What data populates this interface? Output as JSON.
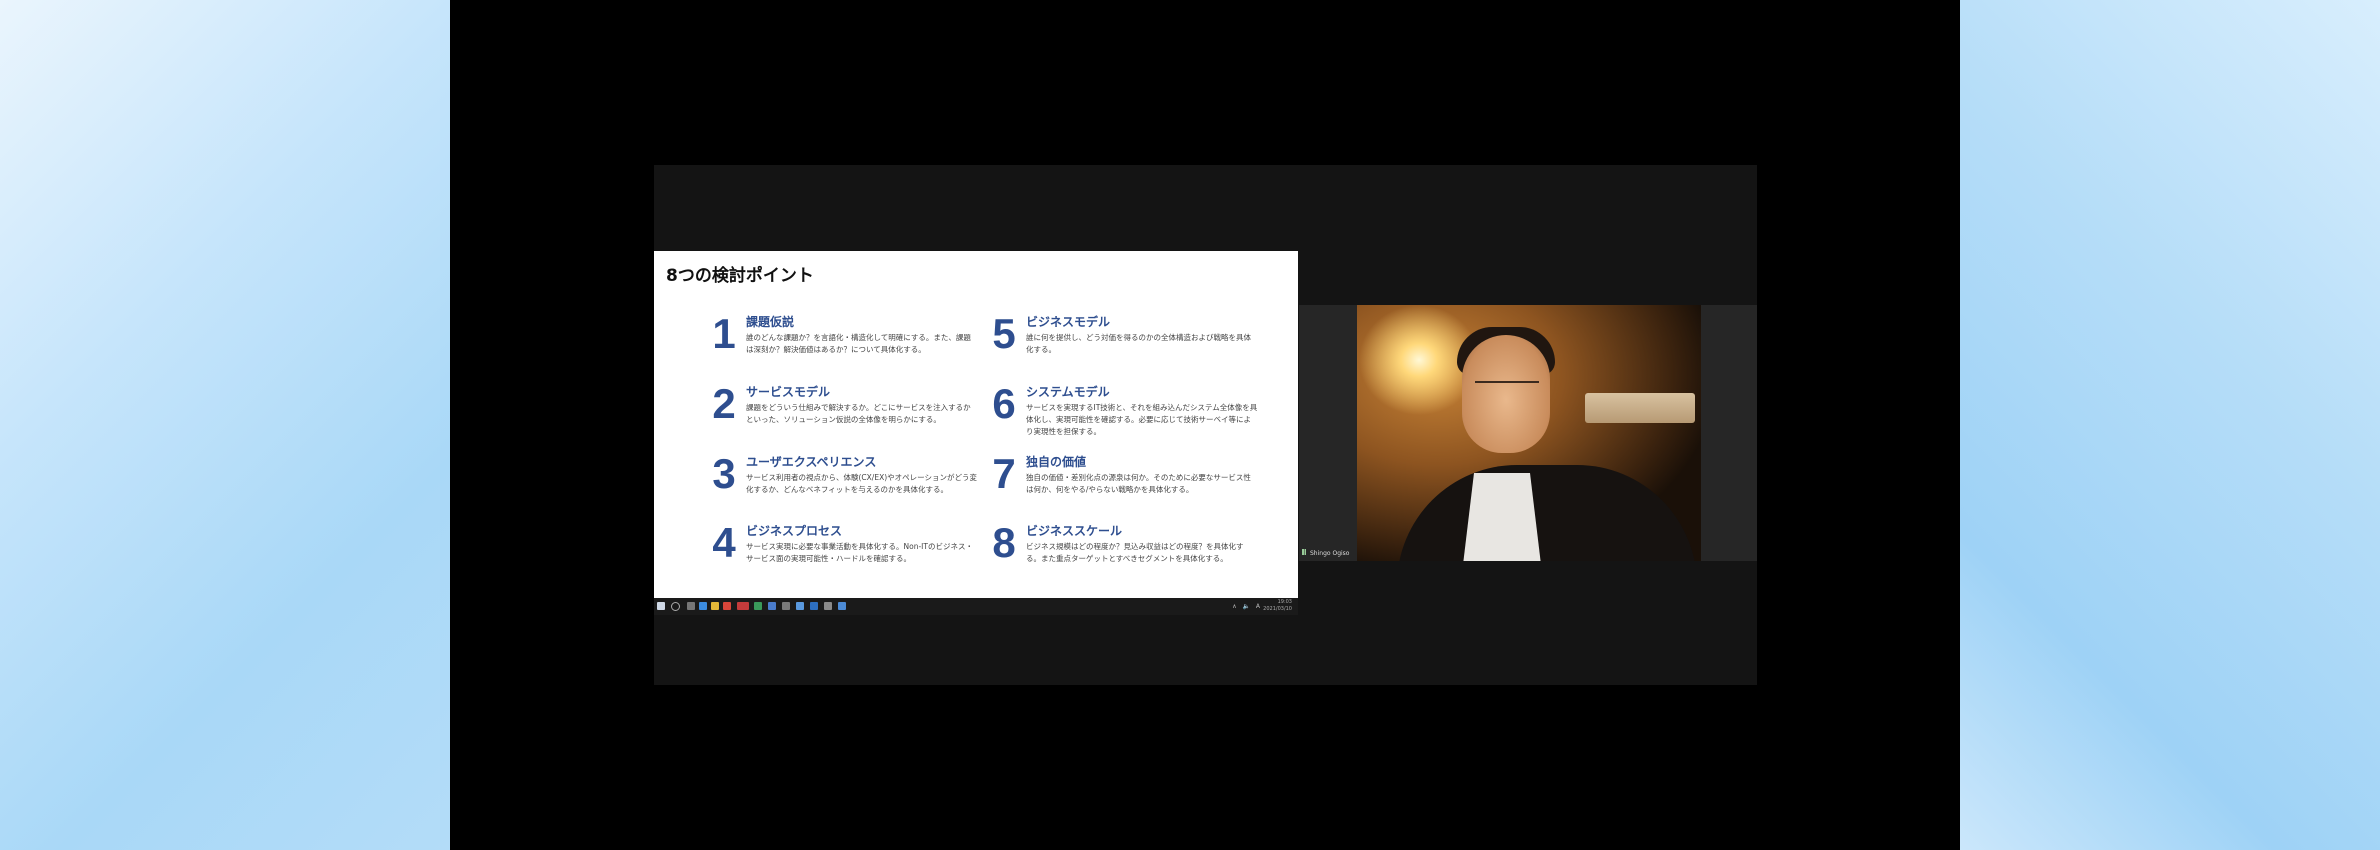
{
  "slide": {
    "title": "8つの検討ポイント",
    "points": [
      {
        "num": "1",
        "title": "課題仮説",
        "desc": "誰のどんな課題か？を言語化・構造化して明確にする。また、課題は深刻か？解決価値はあるか？について具体化する。"
      },
      {
        "num": "2",
        "title": "サービスモデル",
        "desc": "課題をどういう仕組みで解決するか。どこにサービスを注入するかといった、ソリューション仮説の全体像を明らかにする。"
      },
      {
        "num": "3",
        "title": "ユーザエクスペリエンス",
        "desc": "サービス利用者の視点から、体験(CX/EX)やオペレーションがどう変化するか、どんなベネフィットを与えるのかを具体化する。"
      },
      {
        "num": "4",
        "title": "ビジネスプロセス",
        "desc": "サービス実現に必要な事業活動を具体化する。Non-ITのビジネス・サービス面の実現可能性・ハードルを確認する。"
      },
      {
        "num": "5",
        "title": "ビジネスモデル",
        "desc": "誰に何を提供し、どう対価を得るのかの全体構造および戦略を具体化する。"
      },
      {
        "num": "6",
        "title": "システムモデル",
        "desc": "サービスを実現するIT技術と、それを組み込んだシステム全体像を具体化し、実現可能性を確認する。必要に応じて技術サーベイ等により実現性を担保する。"
      },
      {
        "num": "7",
        "title": "独自の価値",
        "desc": "独自の価値・差別化点の源泉は何か。そのために必要なサービス性は何か、何をやる/やらない戦略かを具体化する。"
      },
      {
        "num": "8",
        "title": "ビジネススケール",
        "desc": "ビジネス規模はどの程度か？見込み収益はどの程度？を具体化する。また重点ターゲットとすべきセグメントを具体化する。"
      }
    ]
  },
  "taskbar": {
    "clock_time": "19:03",
    "clock_date": "2021/03/10",
    "tray_icons": "∧ 🔈 A"
  },
  "video": {
    "participant_name": "Shingo Ogiso"
  }
}
